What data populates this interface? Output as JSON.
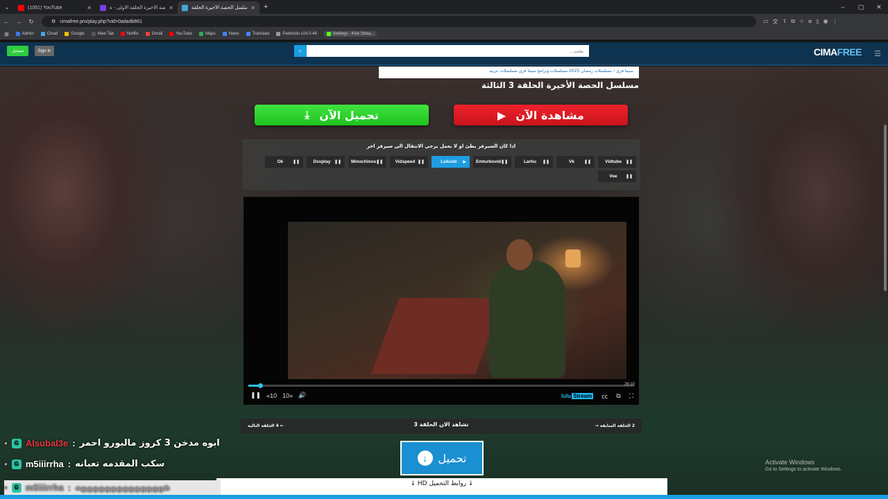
{
  "browser": {
    "tabs": [
      {
        "title": "(1051) YouTube",
        "color": "#ff0000",
        "active": false
      },
      {
        "title": "الحصة الاخيرة الحلقة الاولى - ة...",
        "color": "#7b3fe4",
        "active": false
      },
      {
        "title": "مسلسل الحصة الأخيرة الحلقة",
        "color": "#4aa3df",
        "active": true
      }
    ],
    "url": "cimafree.pro/play.php?vid=0adadb861",
    "bookmarks": [
      {
        "label": "Admin",
        "color": "#3b78e7"
      },
      {
        "label": "Cloud",
        "color": "#4aa3df"
      },
      {
        "label": "Google",
        "color": "#fbbc05"
      },
      {
        "label": "New Tab",
        "color": "#555"
      },
      {
        "label": "Netflix",
        "color": "#e50914"
      },
      {
        "label": "Gmail",
        "color": "#ea4335"
      },
      {
        "label": "YouTube",
        "color": "#ff0000"
      },
      {
        "label": "Maps",
        "color": "#34a853"
      },
      {
        "label": "News",
        "color": "#4285f4"
      },
      {
        "label": "Translate",
        "color": "#4285f4"
      },
      {
        "label": "Paletools v24.0.48",
        "color": "#999"
      },
      {
        "label": "Settings - Kick Strea...",
        "color": "#53fc18"
      }
    ]
  },
  "header": {
    "register_label": "تسجيل",
    "signin_label": "Sign In",
    "search_placeholder": "بحث...",
    "logo_a": "CIMA",
    "logo_b": "FREE"
  },
  "breadcrumb": "سيما فري › مسلسلات رمضان 2025 مسلسلات وبرامج سيما فري مسلسلات عربية",
  "page_title": "مسلسل الحصة الأخيرة الحلقة 3 الثالثة",
  "buttons": {
    "watch": "مشاهدة الآن",
    "download": "تحميل الآن"
  },
  "servers": {
    "note": "اذا كان السيرفر بطئ او لا يعمل يرجي الانتقال الي سيرفر اخر",
    "items": [
      {
        "name": "Vidtube",
        "active": false
      },
      {
        "name": "Vk",
        "active": false
      },
      {
        "name": "Larhu",
        "active": false
      },
      {
        "name": "Emturbovid",
        "active": false
      },
      {
        "name": "Luluvid",
        "active": true
      },
      {
        "name": "Vidspeed",
        "active": false
      },
      {
        "name": "Minochinos",
        "active": false
      },
      {
        "name": "Dsvplay",
        "active": false
      },
      {
        "name": "Ok",
        "active": false
      },
      {
        "name": "Voe",
        "active": false
      }
    ]
  },
  "player": {
    "duration": "26:10",
    "progress": 0.03,
    "rewind": "10",
    "forward": "10",
    "brand_a": "lulu",
    "brand_b": "Stream"
  },
  "episodes": {
    "next": "4 الحلقة التالية",
    "now": "تشاهد الان الحلقة 3",
    "prev": "2 الحلقة السابقة"
  },
  "download_image_label": "تحميل",
  "hd_links": "روابط التحميل HD",
  "chat": [
    {
      "user": "Alsubal3e",
      "msg": "ابوه مدخن 3 كروز مالبورو احمر"
    },
    {
      "user": "m5iiirrha",
      "msg": "سكب المقدمه تعبانه"
    },
    {
      "user": "m5iiirrha",
      "msg": "هههههههههههههههه"
    }
  ],
  "activate": {
    "line1": "Activate Windows",
    "line2": "Go to Settings to activate Windows."
  }
}
